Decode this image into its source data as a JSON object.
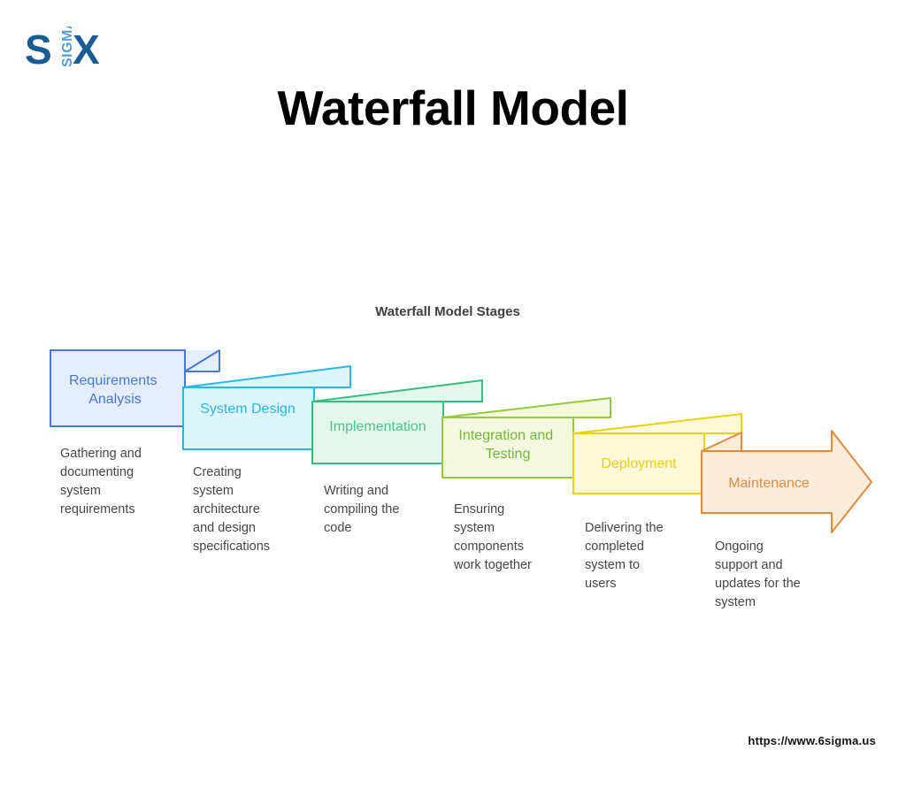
{
  "logo": {
    "letter_left": "S",
    "letter_right": "X",
    "vertical_word": "SIGMA",
    "color_dark": "#1a5c96",
    "color_light": "#4f9fd4"
  },
  "title": "Waterfall Model",
  "chart": {
    "title": "Waterfall Model Stages"
  },
  "chart_data": {
    "type": "diagram",
    "title": "Waterfall Model Stages",
    "layout": "descending-staircase-ribbon",
    "stage_count": 6,
    "stages": [
      {
        "index": 1,
        "label": "Requirements\nAnalysis",
        "label_line1": "Requirements",
        "label_line2": "Analysis",
        "description": "Gathering and\ndocumenting\nsystem\nrequirements",
        "fill": "#e4edfb",
        "stroke": "#4a78d8",
        "text_color": "#4a78d8",
        "shape": "ribbon"
      },
      {
        "index": 2,
        "label": "System Design",
        "label_line1": "System Design",
        "label_line2": "",
        "description": "Creating\nsystem\narchitecture\nand design\nspecifications",
        "fill": "#ddf5fd",
        "stroke": "#2bb6e8",
        "text_color": "#2bb6e8",
        "shape": "ribbon"
      },
      {
        "index": 3,
        "label": "Implementation",
        "label_line1": "Implementation",
        "label_line2": "",
        "description": "Writing and\ncompiling the\ncode",
        "fill": "#e3f7ec",
        "stroke": "#35bd7e",
        "text_color": "#4cc38a",
        "shape": "ribbon"
      },
      {
        "index": 4,
        "label": "Integration and\nTesting",
        "label_line1": "Integration and",
        "label_line2": "Testing",
        "description": "Ensuring\nsystem\ncomponents\nwork together",
        "fill": "#f4f8e0",
        "stroke": "#96c93d",
        "text_color": "#72b83a",
        "shape": "ribbon"
      },
      {
        "index": 5,
        "label": "Deployment",
        "label_line1": "Deployment",
        "label_line2": "",
        "description": "Delivering the\ncompleted\nsystem to\nusers",
        "fill": "#fcf8d8",
        "stroke": "#e8d311",
        "text_color": "#e9cf22",
        "shape": "ribbon"
      },
      {
        "index": 6,
        "label": "Maintenance",
        "label_line1": "Maintenance",
        "label_line2": "",
        "description": "Ongoing\nsupport and\nupdates for the\nsystem",
        "fill": "#fcecdc",
        "stroke": "#e08b3f",
        "text_color": "#e08b3f",
        "shape": "arrow"
      }
    ]
  },
  "footer": {
    "url": "https://www.6sigma.us"
  }
}
